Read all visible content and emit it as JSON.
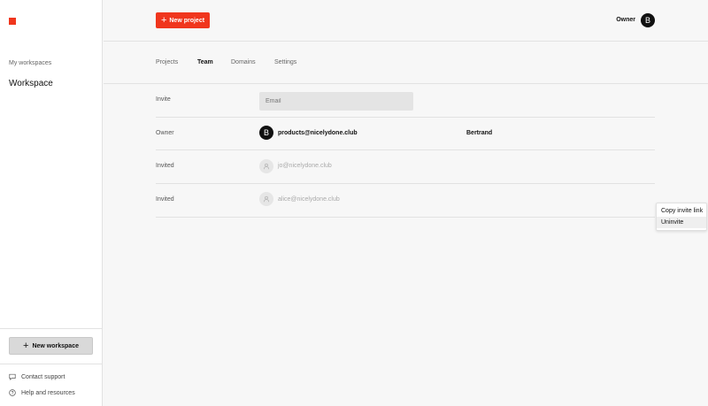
{
  "sidebar": {
    "section_label": "My workspaces",
    "workspace_name": "Workspace",
    "new_workspace_label": "New workspace",
    "links": [
      {
        "label": "Contact support",
        "icon": "chat-icon"
      },
      {
        "label": "Help and resources",
        "icon": "help-circle-icon"
      }
    ]
  },
  "header": {
    "new_project_label": "New project",
    "owner_label": "Owner",
    "avatar_initial": "B"
  },
  "tabs": [
    {
      "label": "Projects",
      "active": false
    },
    {
      "label": "Team",
      "active": true
    },
    {
      "label": "Domains",
      "active": false
    },
    {
      "label": "Settings",
      "active": false
    }
  ],
  "team": {
    "invite_label": "Invite",
    "invite_placeholder": "Email",
    "members": [
      {
        "role": "Owner",
        "initial": "B",
        "email": "products@nicelydone.club",
        "name": "Bertrand"
      },
      {
        "role": "Invited",
        "email": "jo@nicelydone.club"
      },
      {
        "role": "Invited",
        "email": "alice@nicelydone.club"
      }
    ]
  },
  "context_menu": {
    "items": [
      "Copy invite link",
      "Uninvite"
    ]
  },
  "colors": {
    "accent": "#f0361d",
    "background": "#f7f7f7",
    "sidebar": "#ffffff"
  }
}
